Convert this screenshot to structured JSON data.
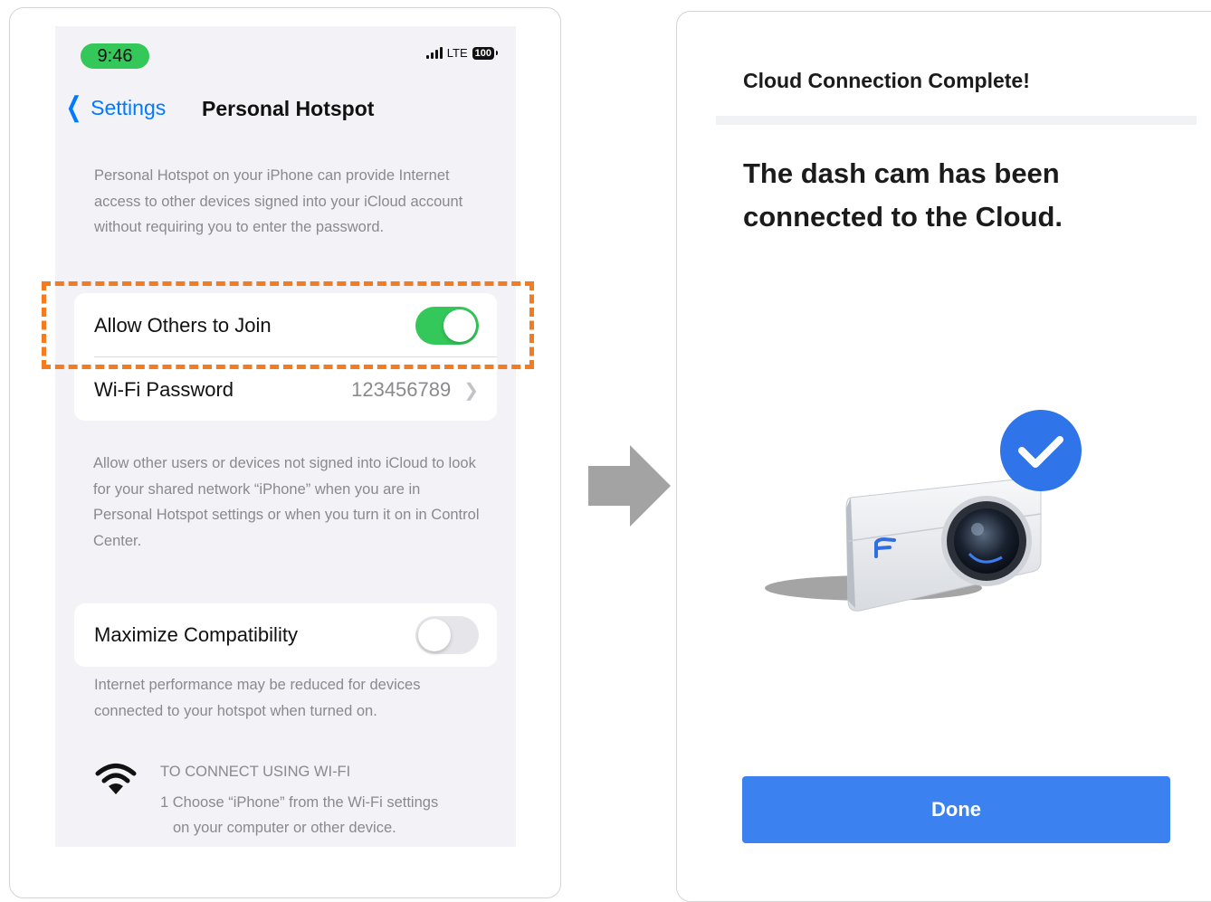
{
  "left_panel": {
    "status_bar": {
      "time": "9:46",
      "network": "LTE",
      "battery": "100"
    },
    "nav": {
      "back_label": "Settings",
      "title": "Personal Hotspot"
    },
    "intro_text": "Personal Hotspot on your iPhone can provide Internet access to other devices signed into your iCloud account without requiring you to enter the password.",
    "settings": {
      "allow_others": {
        "label": "Allow Others to Join",
        "enabled": true
      },
      "wifi_password": {
        "label": "Wi-Fi Password",
        "value": "123456789"
      }
    },
    "network_text": "Allow other users or devices not signed into iCloud to look for your shared network “iPhone” when you are in Personal Hotspot settings or when you turn it on in Control Center.",
    "compatibility": {
      "label": "Maximize Compatibility",
      "enabled": false
    },
    "compatibility_text": "Internet performance may be reduced for devices connected to your hotspot when turned on.",
    "wifi_connect": {
      "heading": "TO CONNECT USING WI-FI",
      "step_line1": "1 Choose “iPhone” from the Wi-Fi settings",
      "step_line2": "on your computer or other device."
    },
    "highlight_color": "#f37b20"
  },
  "right_panel": {
    "title": "Cloud Connection Complete!",
    "heading_line1": "The dash cam has been",
    "heading_line2": "connected to the Cloud.",
    "done_label": "Done",
    "accent_color": "#3b82f0",
    "illustration": "dash-cam-with-checkmark"
  }
}
